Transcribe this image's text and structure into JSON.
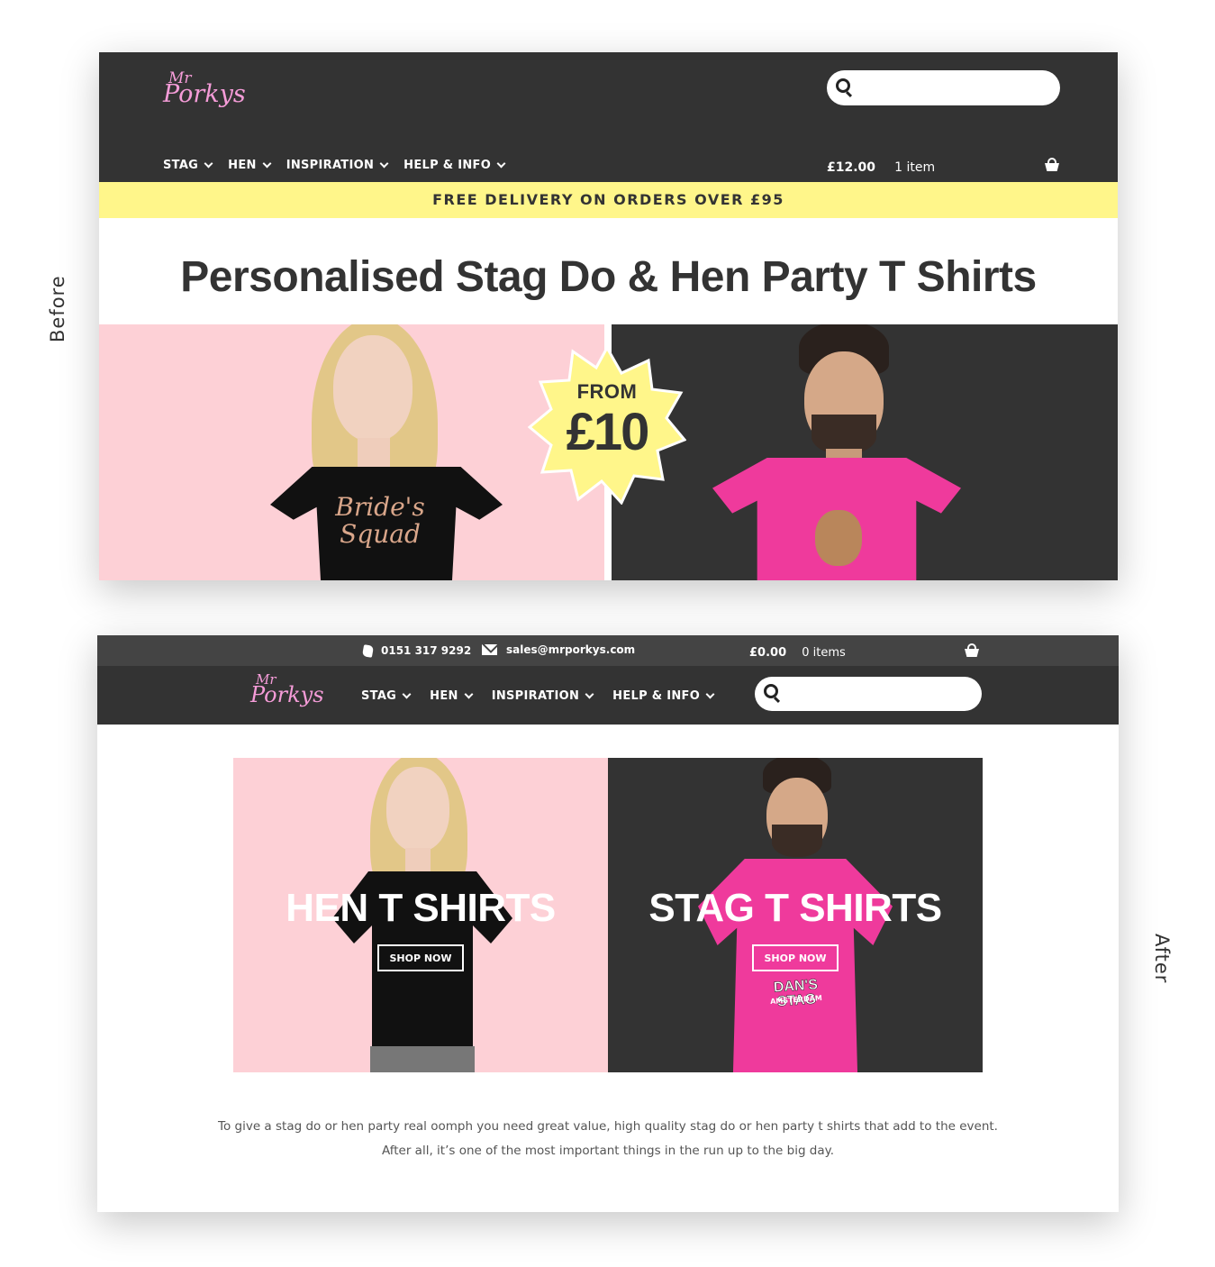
{
  "labels": {
    "before": "Before",
    "after": "After"
  },
  "brand": {
    "line1": "Mr",
    "line2": "Porkys",
    "color": "#f59cd8"
  },
  "colors": {
    "dark": "#333333",
    "topbar": "#444444",
    "promo": "#fff68a",
    "pink": "#fdd0d6",
    "tee_pink": "#ef3a9c"
  },
  "before": {
    "nav": [
      "STAG",
      "HEN",
      "INSPIRATION",
      "HELP & INFO"
    ],
    "cart": {
      "total": "£12.00",
      "count": "1 item",
      "icon": "basket-icon"
    },
    "search": {
      "placeholder": "",
      "icon": "search-icon"
    },
    "promo": "FREE DELIVERY ON ORDERS OVER £95",
    "headline": "Personalised Stag Do & Hen Party T Shirts",
    "burst": {
      "line1": "FROM",
      "line2": "£10"
    },
    "shirt_print": "Bride's Squad"
  },
  "after": {
    "contact": {
      "phone": "0151 317 9292",
      "email": "sales@mrporkys.com"
    },
    "cart": {
      "total": "£0.00",
      "count": "0 items",
      "icon": "basket-icon"
    },
    "nav": [
      "STAG",
      "HEN",
      "INSPIRATION",
      "HELP & INFO"
    ],
    "search": {
      "placeholder": "",
      "icon": "search-icon"
    },
    "hen": {
      "title": "HEN T SHIRTS",
      "button": "SHOP NOW"
    },
    "stag": {
      "title": "STAG T SHIRTS",
      "button": "SHOP NOW",
      "print": "DAN'S STAG",
      "print_sub": "AMSTERDAM"
    },
    "intro": [
      "To give a stag do or hen party real oomph you need great value, high quality stag do or hen party t shirts that add to the event.",
      "After all, it’s one of the most important things in the run up to the big day."
    ]
  }
}
